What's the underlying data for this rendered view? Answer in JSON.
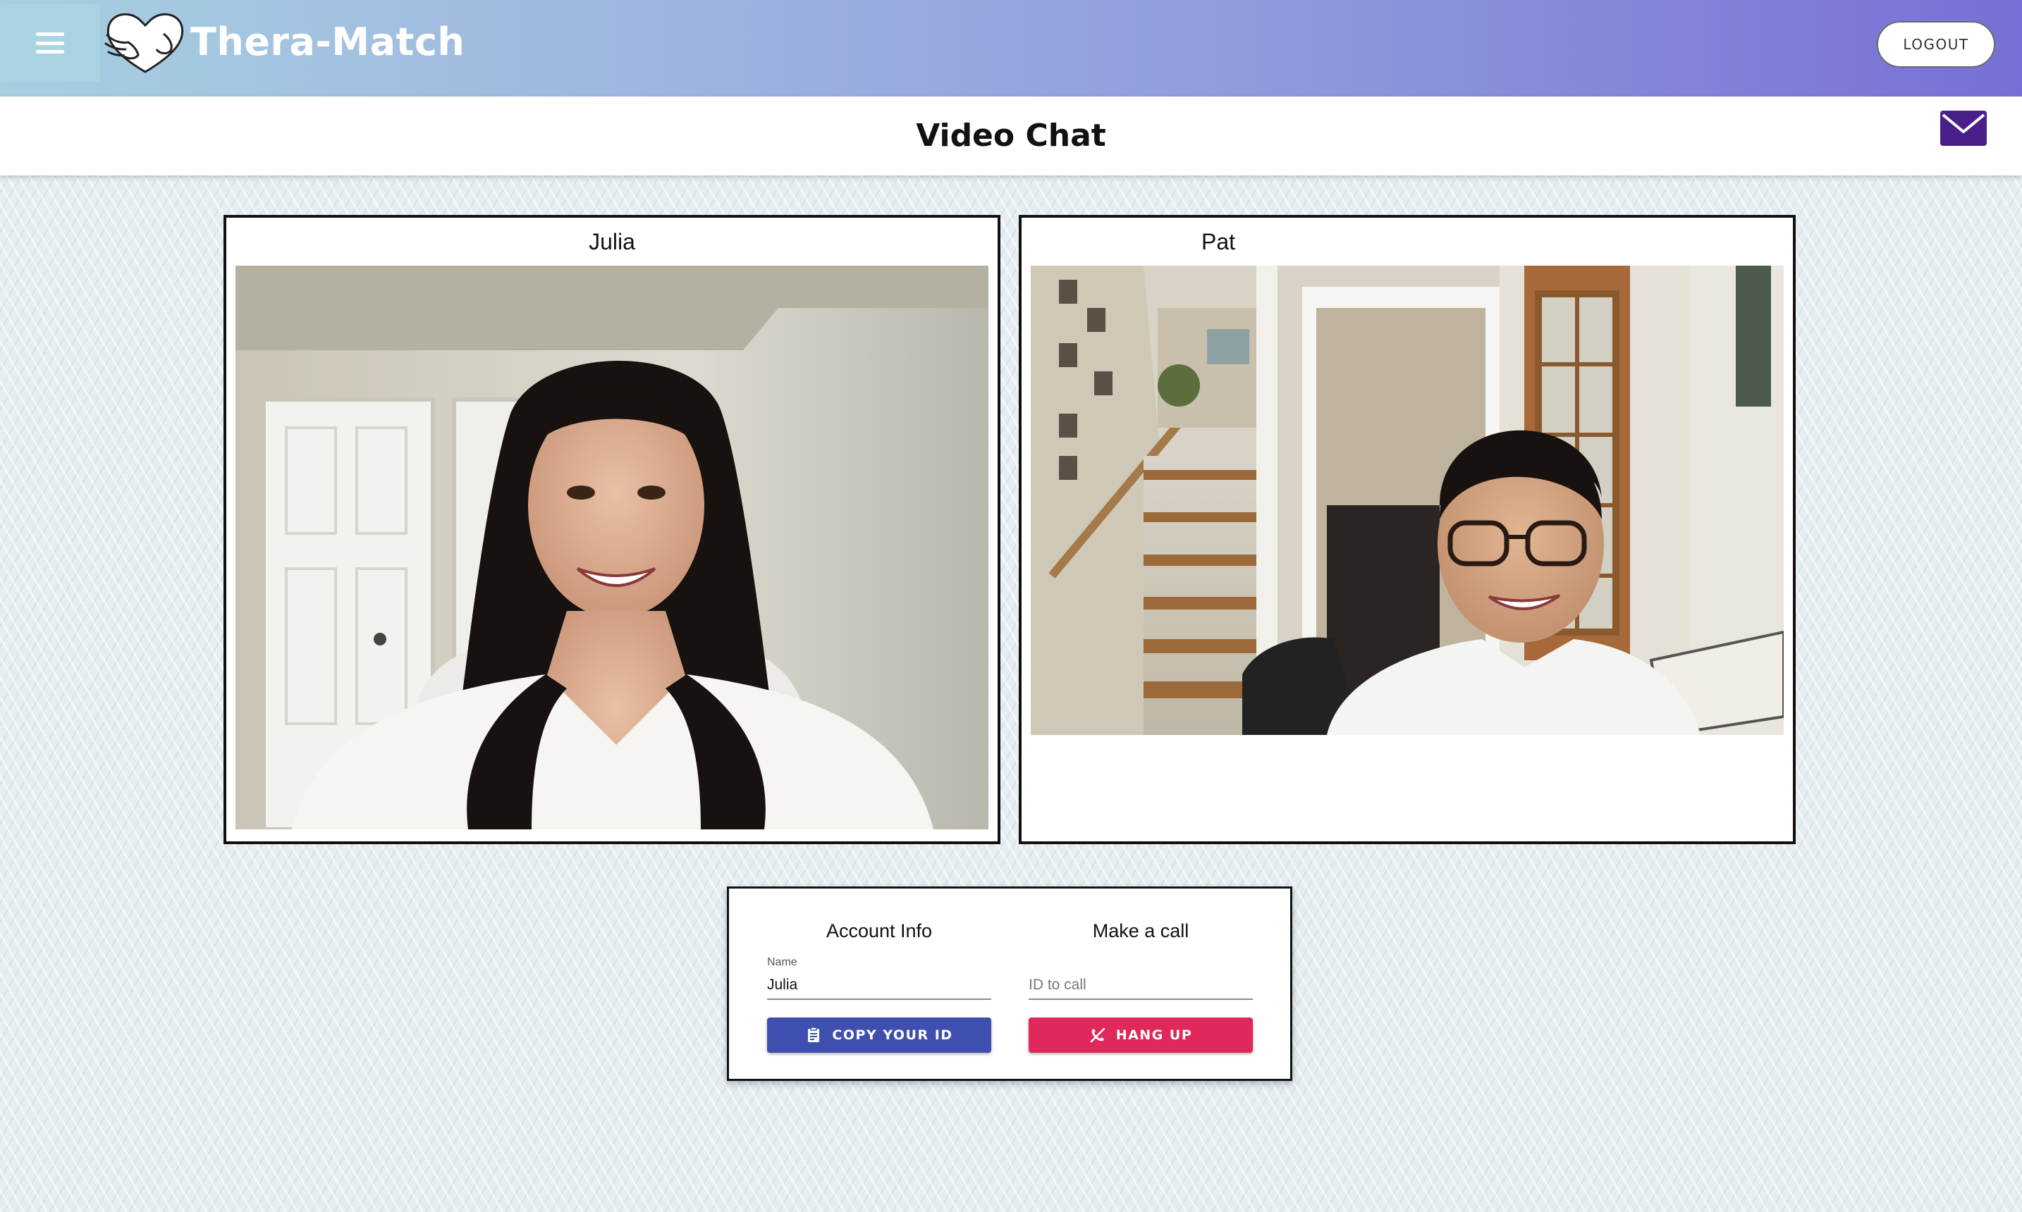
{
  "app": {
    "brand": "Thera-Match",
    "logout_label": "LOGOUT"
  },
  "page": {
    "title": "Video Chat"
  },
  "videos": [
    {
      "label": "Julia"
    },
    {
      "label": "Pat"
    }
  ],
  "account": {
    "title": "Account Info",
    "name_label": "Name",
    "name_value": "Julia",
    "copy_button": "COPY YOUR ID"
  },
  "call": {
    "title": "Make a call",
    "id_placeholder": "ID to call",
    "hangup_button": "HANG UP"
  },
  "icons": {
    "menu": "menu-icon",
    "logo": "heart-hands-logo",
    "mail": "mail-icon",
    "clipboard": "clipboard-icon",
    "call_end": "call-end-icon"
  },
  "colors": {
    "accent_blue": "#3f4fb0",
    "accent_red": "#e0285a",
    "mail_purple": "#4b1f8a"
  }
}
